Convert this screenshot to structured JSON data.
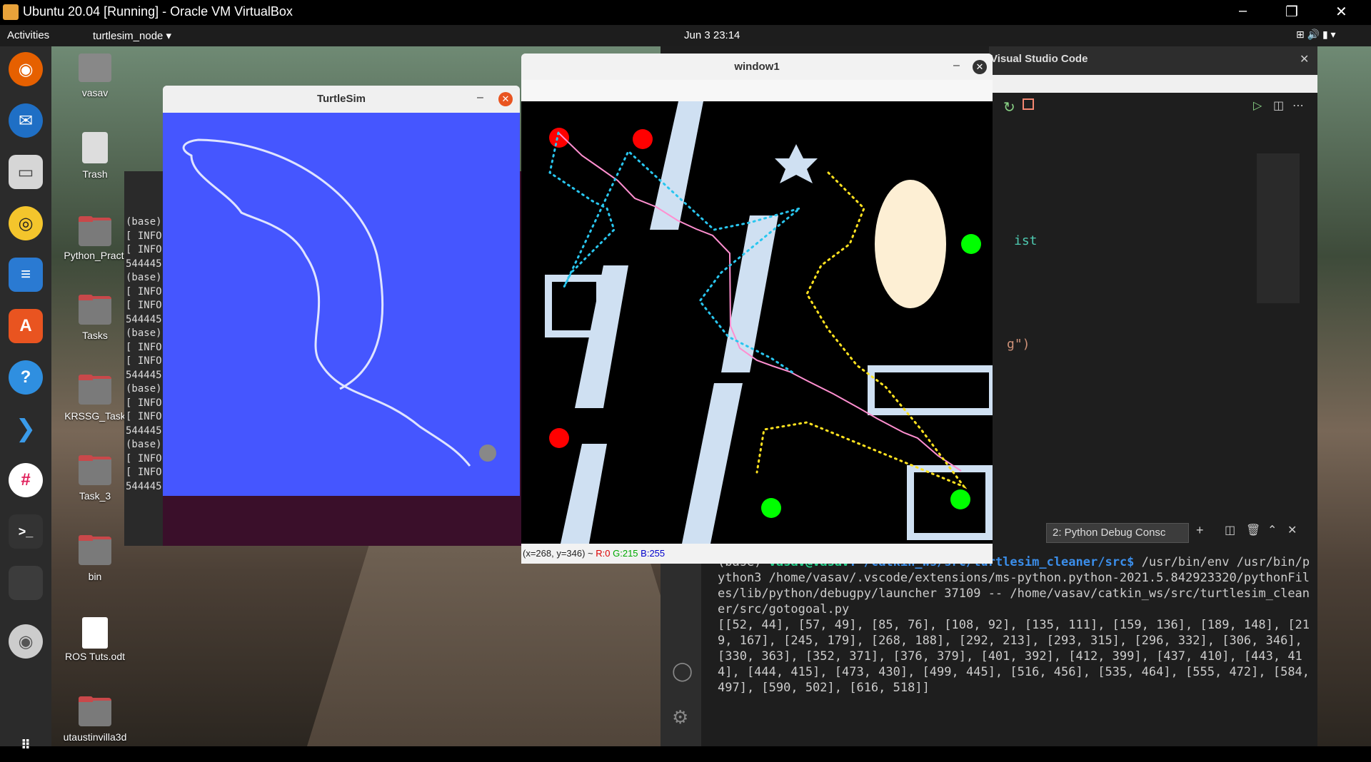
{
  "vbox": {
    "title": "Ubuntu 20.04 [Running] - Oracle VM VirtualBox",
    "min": "–",
    "max": "❐",
    "close": "✕"
  },
  "topbar": {
    "activities": "Activities",
    "app": "turtlesim_node ▾",
    "clock": "Jun 3  23:14"
  },
  "desktop_icons": [
    "vasav",
    "Trash",
    "Python_Practi",
    "Tasks",
    "KRSSG_Task",
    "Task_3",
    "bin",
    "ROS Tuts.odt",
    "utaustinvilla3d"
  ],
  "terminal_lines": [
    "(base)",
    "[ INFO",
    "[ INFO",
    "544445",
    "(base)",
    "[ INFO",
    "[ INFO",
    "544445",
    "(base)",
    "[ INFO",
    "[ INFO",
    "544445",
    "(base)",
    "[ INFO",
    "[ INFO",
    "544445",
    "(base)",
    "[ INFO",
    "[ INFO",
    "544445"
  ],
  "turtlesim": {
    "title": "TurtleSim",
    "min": "–",
    "close": "✕",
    "bg": "#4556ff"
  },
  "window1": {
    "title": "window1",
    "min": "–",
    "close": "✕",
    "status_prefix": "(x=268, y=346) ~ ",
    "r": "R:0",
    "g": "G:215",
    "b": "B:255"
  },
  "vscode": {
    "title": "Visual Studio Code",
    "code_frag1": "ist",
    "code_frag2": "g\")",
    "debug_select": "2: Python Debug Consc",
    "prompt_prefix": "(base) ",
    "prompt_user": "vasav@vasav",
    "prompt_path": ":~/catkin_ws/src/turtlesim_cleaner/src$",
    "cmd": " /usr/bin/env /usr/bin/python3 /home/vasav/.vscode/extensions/ms-python.python-2021.5.842923320/pythonFiles/lib/python/debugpy/launcher 37109 -- /home/vasav/catkin_ws/src/turtlesim_cleaner/src/gotogoal.py",
    "output": "[[52, 44], [57, 49], [85, 76], [108, 92], [135, 111], [159, 136], [189, 148], [219, 167], [245, 179], [268, 188], [292, 213], [293, 315], [296, 332], [306, 346], [330, 363], [352, 371], [376, 379], [401, 392], [412, 399], [437, 410], [443, 414], [444, 415], [473, 430], [499, 445], [516, 456], [535, 464], [555, 472], [584, 497], [590, 502], [616, 518]]"
  }
}
